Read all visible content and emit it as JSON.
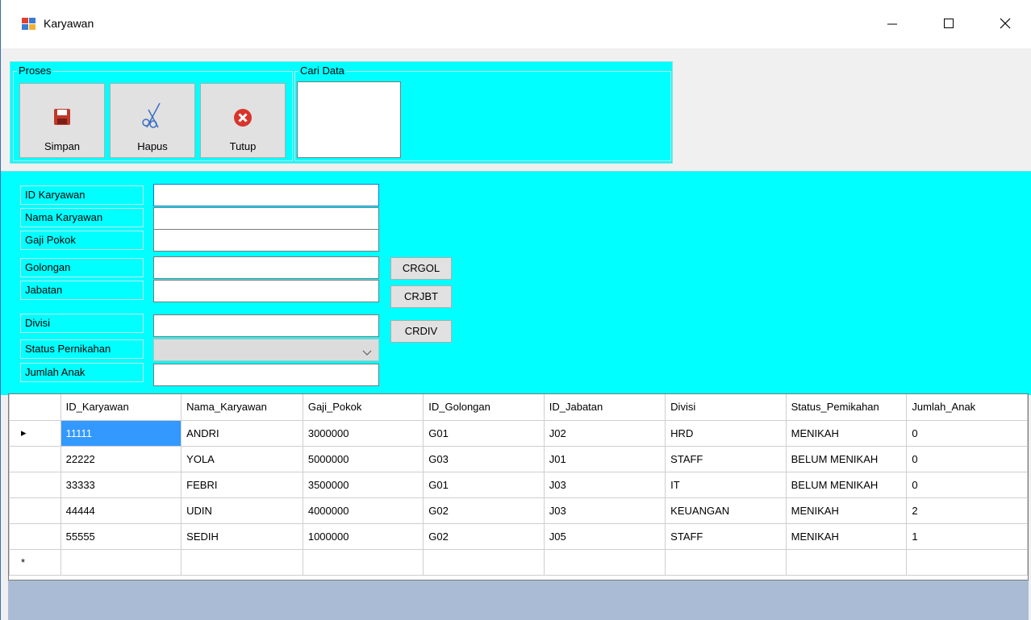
{
  "window": {
    "title": "Karyawan",
    "icons": {
      "app": "app-form-icon",
      "minimize": "minimize-icon",
      "maximize": "maximize-icon",
      "close": "close-icon"
    }
  },
  "toolbar": {
    "proses_label": "Proses",
    "cari_label": "Cari Data",
    "buttons": [
      {
        "label": "Simpan",
        "icon": "save-icon"
      },
      {
        "label": "Hapus",
        "icon": "scissors-icon"
      },
      {
        "label": "Tutup",
        "icon": "close-circle-icon"
      }
    ]
  },
  "form": {
    "fields": {
      "id_karyawan": {
        "label": "ID Karyawan",
        "value": ""
      },
      "nama_karyawan": {
        "label": "Nama Karyawan",
        "value": ""
      },
      "gaji_pokok": {
        "label": "Gaji Pokok",
        "value": ""
      },
      "golongan": {
        "label": "Golongan",
        "value": ""
      },
      "jabatan": {
        "label": "Jabatan",
        "value": ""
      },
      "divisi": {
        "label": "Divisi",
        "value": ""
      },
      "status_pernikahan": {
        "label": "Status Pernikahan",
        "value": ""
      },
      "jumlah_anak": {
        "label": "Jumlah Anak",
        "value": ""
      }
    },
    "buttons": {
      "crgol": "CRGOL",
      "crjbt": "CRJBT",
      "crdiv": "CRDIV"
    }
  },
  "grid": {
    "columns": [
      "ID_Karyawan",
      "Nama_Karyawan",
      "Gaji_Pokok",
      "ID_Golongan",
      "ID_Jabatan",
      "Divisi",
      "Status_Pemikahan",
      "Jumlah_Anak"
    ],
    "rows": [
      [
        "11111",
        "ANDRI",
        "3000000",
        "G01",
        "J02",
        "HRD",
        "MENIKAH",
        "0"
      ],
      [
        "22222",
        "YOLA",
        "5000000",
        "G03",
        "J01",
        "STAFF",
        "BELUM MENIKAH",
        "0"
      ],
      [
        "33333",
        "FEBRI",
        "3500000",
        "G01",
        "J03",
        "IT",
        "BELUM MENIKAH",
        "0"
      ],
      [
        "44444",
        "UDIN",
        "4000000",
        "G02",
        "J03",
        "KEUANGAN",
        "MENIKAH",
        "2"
      ],
      [
        "55555",
        "SEDIH",
        "1000000",
        "G02",
        "J05",
        "STAFF",
        "MENIKAH",
        "1"
      ]
    ],
    "current_row_marker": "▸",
    "new_row_marker": "*"
  },
  "colors": {
    "panel": "#00ffff",
    "selection": "#3399ff",
    "bottom": "#aabcd5"
  }
}
